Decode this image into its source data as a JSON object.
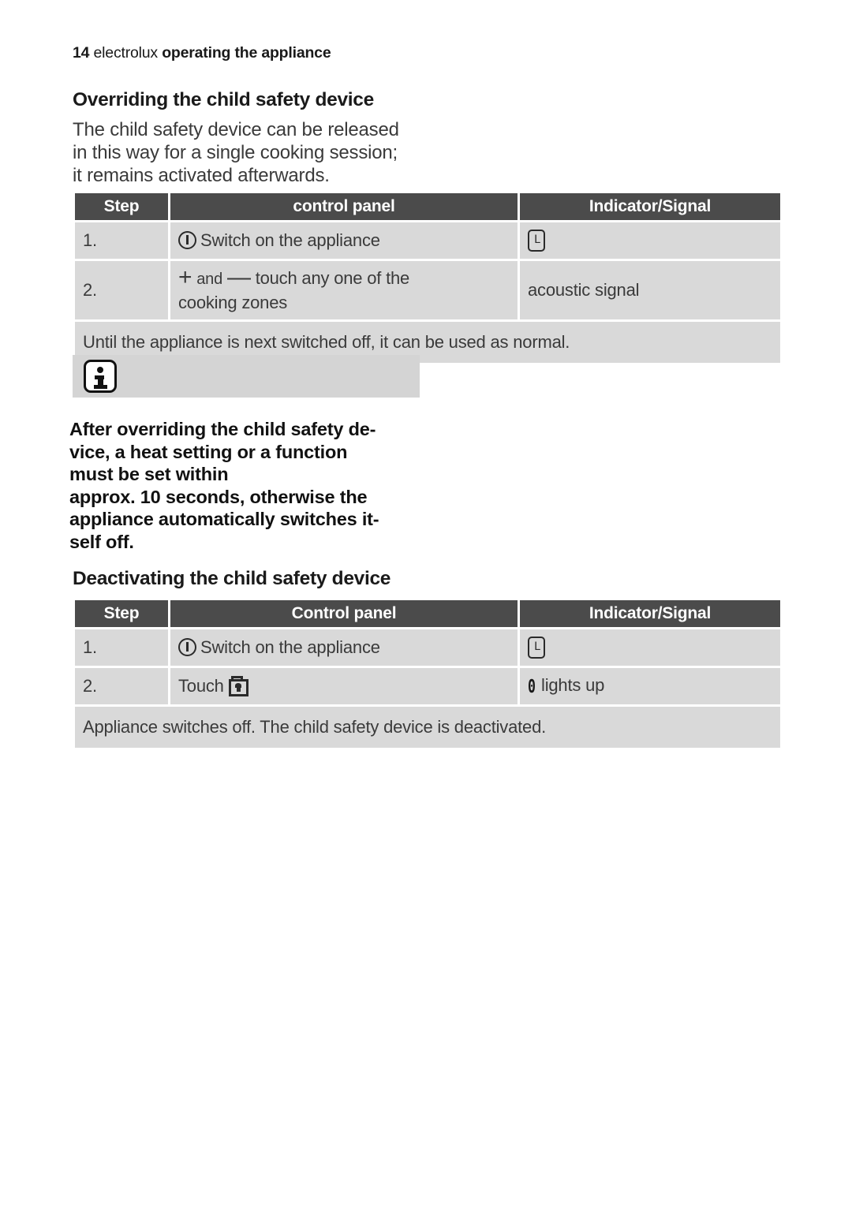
{
  "header": {
    "page_number": "14",
    "brand": "electrolux",
    "section": "operating the appliance"
  },
  "sections": [
    {
      "heading": "Overriding the child safety device",
      "intro_lines": [
        "The child safety device can be released",
        "in this way for a single cooking session;",
        "it remains activated afterwards."
      ]
    },
    {
      "heading": "Deactivating the child safety device"
    }
  ],
  "table_override": {
    "columns": [
      "Step",
      "control panel",
      "Indicator/Signal"
    ],
    "rows": [
      {
        "step": "1.",
        "panel_icon": "power-icon",
        "panel": "Switch on the appliance",
        "signal_icon": "indicator-L-box",
        "signal": ""
      },
      {
        "step": "2.",
        "panel_symbol_plus": "+",
        "panel_conjunction": "and",
        "panel_symbol_minus": "—",
        "panel_line1": "touch any one of the",
        "panel_line2": "cooking zones",
        "signal": "acoustic signal"
      }
    ],
    "footer": "Until the appliance is next switched off, it can be used as normal."
  },
  "info_note": {
    "icon": "information-icon",
    "paragraph_1": [
      "After overriding the child safety de-",
      "vice, a heat setting or a function",
      "must be set within"
    ],
    "paragraph_2": [
      "approx. 10 seconds, otherwise the",
      "appliance automatically switches it-",
      "self off."
    ]
  },
  "table_deactivate": {
    "columns": [
      "Step",
      "Control panel",
      "Indicator/Signal"
    ],
    "rows": [
      {
        "step": "1.",
        "panel_icon": "power-icon",
        "panel": "Switch on the appliance",
        "signal_icon": "indicator-L-box",
        "signal": ""
      },
      {
        "step": "2.",
        "panel": "Touch",
        "panel_icon_trailing": "lock-icon",
        "signal_icon": "seven-segment-zero",
        "signal": "lights up"
      }
    ],
    "footer": "Appliance switches off. The child safety device is deactivated."
  },
  "colors": {
    "header_row_bg": "#4b4b4b",
    "cell_bg": "#d9d9d9",
    "banner_bg": "#d4d4d4",
    "text": "#3a3a3a",
    "page_bg": "#ffffff"
  },
  "glyphs": {
    "indicator_L": "L",
    "seven_segment_zero": "0"
  }
}
